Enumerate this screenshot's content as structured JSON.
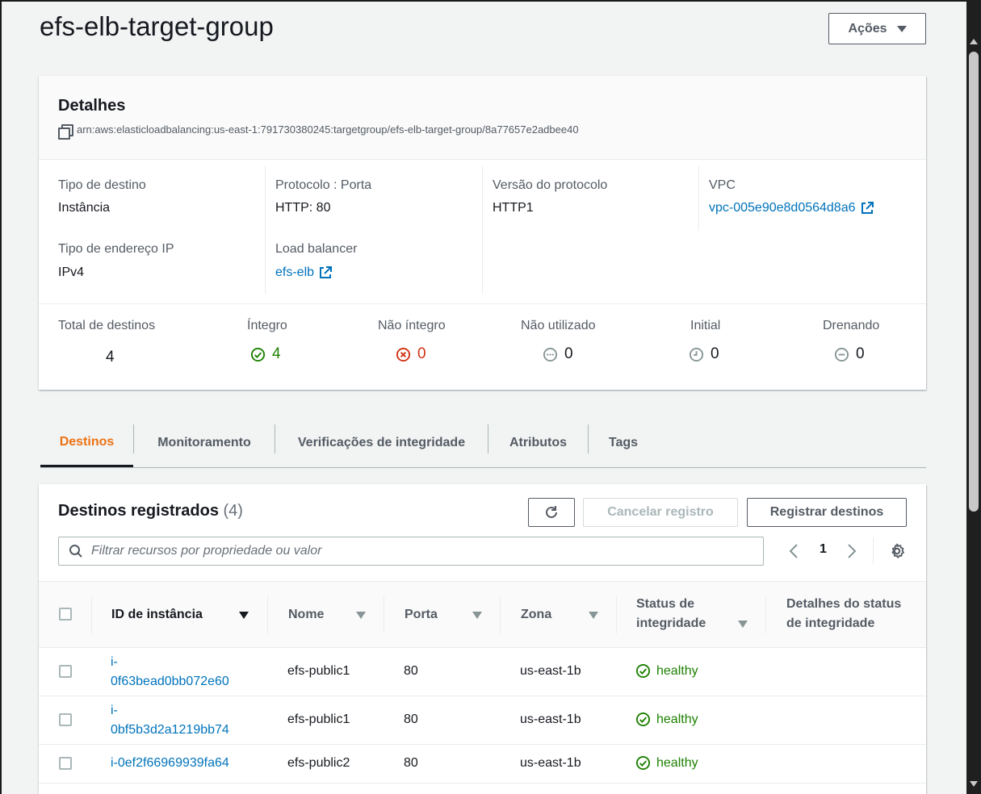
{
  "page": {
    "title": "efs-elb-target-group"
  },
  "actions": {
    "label": "Ações"
  },
  "details": {
    "title": "Detalhes",
    "arn": "arn:aws:elasticloadbalancing:us-east-1:791730380245:targetgroup/efs-elb-target-group/8a77657e2adbee40",
    "fields": {
      "target_type": {
        "label": "Tipo de destino",
        "value": "Instância"
      },
      "protocol_port": {
        "label": "Protocolo : Porta",
        "value": "HTTP: 80"
      },
      "protocol_version": {
        "label": "Versão do protocolo",
        "value": "HTTP1"
      },
      "vpc": {
        "label": "VPC",
        "value": "vpc-005e90e8d0564d8a6"
      },
      "ip_address_type": {
        "label": "Tipo de endereço IP",
        "value": "IPv4"
      },
      "load_balancer": {
        "label": "Load balancer",
        "value": "efs-elb"
      }
    },
    "stats": {
      "total": {
        "label": "Total de destinos",
        "value": "4"
      },
      "healthy": {
        "label": "Íntegro",
        "value": "4"
      },
      "unhealthy": {
        "label": "Não íntegro",
        "value": "0"
      },
      "unused": {
        "label": "Não utilizado",
        "value": "0"
      },
      "initial": {
        "label": "Initial",
        "value": "0"
      },
      "draining": {
        "label": "Drenando",
        "value": "0"
      }
    }
  },
  "tabs": [
    {
      "label": "Destinos",
      "active": true
    },
    {
      "label": "Monitoramento"
    },
    {
      "label": "Verificações de integridade"
    },
    {
      "label": "Atributos"
    },
    {
      "label": "Tags"
    }
  ],
  "targets": {
    "title": "Destinos registrados",
    "count": "(4)",
    "deregister_label": "Cancelar registro",
    "register_label": "Registrar destinos",
    "filter_placeholder": "Filtrar recursos por propriedade ou valor",
    "current_page": "1",
    "columns": {
      "instance_id": "ID de instância",
      "name": "Nome",
      "port": "Porta",
      "zone": "Zona",
      "health_status_line1": "Status de",
      "health_status_line2": "integridade",
      "health_details_line1": "Detalhes do status",
      "health_details_line2": "de integridade"
    },
    "rows": [
      {
        "id_line1": "i-",
        "id_line2": "0f63bead0bb072e60",
        "name": "efs-public1",
        "port": "80",
        "zone": "us-east-1b",
        "status": "healthy"
      },
      {
        "id_line1": "i-",
        "id_line2": "0bf5b3d2a1219bb74",
        "name": "efs-public1",
        "port": "80",
        "zone": "us-east-1b",
        "status": "healthy"
      },
      {
        "id_line1": "i-0ef2f66969939fa64",
        "id_line2": "",
        "name": "efs-public2",
        "port": "80",
        "zone": "us-east-1b",
        "status": "healthy"
      }
    ]
  },
  "colors": {
    "link": "#0073bb",
    "healthy": "#1d8102",
    "unhealthy": "#d13212",
    "active_tab": "#ec7211",
    "muted": "#879596"
  }
}
